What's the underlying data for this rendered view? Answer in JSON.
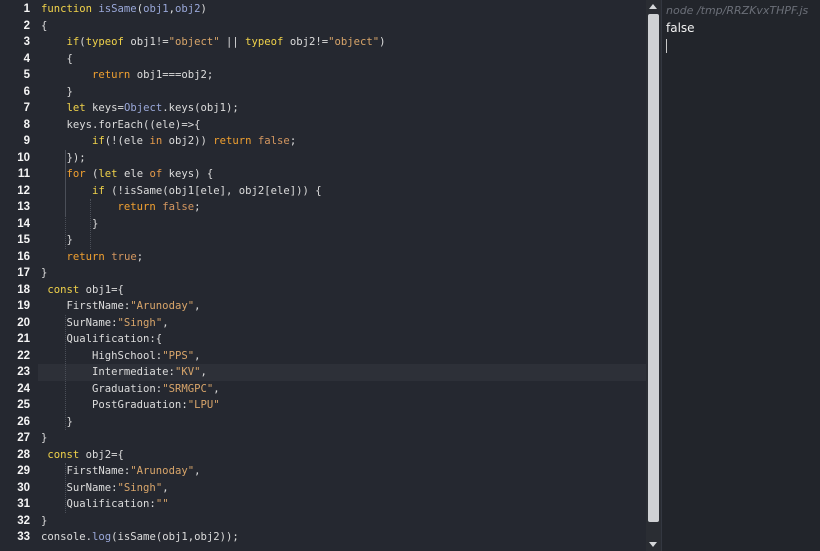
{
  "editor": {
    "line_numbers": [
      "1",
      "2",
      "3",
      "4",
      "5",
      "6",
      "7",
      "8",
      "9",
      "10",
      "11",
      "12",
      "13",
      "14",
      "15",
      "16",
      "17",
      "18",
      "19",
      "20",
      "21",
      "22",
      "23",
      "24",
      "25",
      "26",
      "27",
      "28",
      "29",
      "30",
      "31",
      "32",
      "33"
    ],
    "active_line": 23,
    "lines": [
      [
        [
          "k",
          "function"
        ],
        [
          "n",
          " "
        ],
        [
          "o",
          "isSame"
        ],
        [
          "n",
          "("
        ],
        [
          "o",
          "obj1"
        ],
        [
          "n",
          ","
        ],
        [
          "o",
          "obj2"
        ],
        [
          "n",
          ")"
        ]
      ],
      [
        [
          "n",
          "{"
        ]
      ],
      [
        [
          "n",
          "    "
        ],
        [
          "k",
          "if"
        ],
        [
          "n",
          "("
        ],
        [
          "k",
          "typeof"
        ],
        [
          "n",
          " obj1!="
        ],
        [
          "s",
          "\"object\""
        ],
        [
          "n",
          " || "
        ],
        [
          "k",
          "typeof"
        ],
        [
          "n",
          " obj2!="
        ],
        [
          "s",
          "\"object\""
        ],
        [
          "n",
          ")"
        ]
      ],
      [
        [
          "n",
          "    {"
        ]
      ],
      [
        [
          "n",
          "        "
        ],
        [
          "kr",
          "return"
        ],
        [
          "n",
          " obj1===obj2;"
        ]
      ],
      [
        [
          "n",
          "    }"
        ]
      ],
      [
        [
          "n",
          "    "
        ],
        [
          "k",
          "let"
        ],
        [
          "n",
          " keys="
        ],
        [
          "o",
          "Object"
        ],
        [
          "n",
          ".keys(obj1);"
        ]
      ],
      [
        [
          "n",
          "    keys.forEach((ele)=>{"
        ]
      ],
      [
        [
          "n",
          "        "
        ],
        [
          "k",
          "if"
        ],
        [
          "n",
          "(!(ele "
        ],
        [
          "kp",
          "in"
        ],
        [
          "n",
          " obj2)) "
        ],
        [
          "kr",
          "return"
        ],
        [
          "n",
          " "
        ],
        [
          "b",
          "false"
        ],
        [
          "n",
          ";"
        ]
      ],
      [
        [
          "n",
          "    });"
        ]
      ],
      [
        [
          "n",
          "    "
        ],
        [
          "kr",
          "for"
        ],
        [
          "n",
          " ("
        ],
        [
          "k",
          "let"
        ],
        [
          "n",
          " ele "
        ],
        [
          "kp",
          "of"
        ],
        [
          "n",
          " keys) {"
        ]
      ],
      [
        [
          "n",
          "        "
        ],
        [
          "k",
          "if"
        ],
        [
          "n",
          " (!isSame(obj1[ele], obj2[ele])) {"
        ]
      ],
      [
        [
          "n",
          "            "
        ],
        [
          "kr",
          "return"
        ],
        [
          "n",
          " "
        ],
        [
          "b",
          "false"
        ],
        [
          "n",
          ";"
        ]
      ],
      [
        [
          "n",
          "        }"
        ]
      ],
      [
        [
          "n",
          "    }"
        ]
      ],
      [
        [
          "n",
          "    "
        ],
        [
          "kr",
          "return"
        ],
        [
          "n",
          " "
        ],
        [
          "b",
          "true"
        ],
        [
          "n",
          ";"
        ]
      ],
      [
        [
          "n",
          "}"
        ]
      ],
      [
        [
          "n",
          " "
        ],
        [
          "k",
          "const"
        ],
        [
          "n",
          " obj1={"
        ]
      ],
      [
        [
          "n",
          "    FirstName:"
        ],
        [
          "s",
          "\"Arunoday\""
        ],
        [
          "n",
          ","
        ]
      ],
      [
        [
          "n",
          "    SurName:"
        ],
        [
          "s",
          "\"Singh\""
        ],
        [
          "n",
          ","
        ]
      ],
      [
        [
          "n",
          "    Qualification:{"
        ]
      ],
      [
        [
          "n",
          "        HighSchool:"
        ],
        [
          "s",
          "\"PPS\""
        ],
        [
          "n",
          ","
        ]
      ],
      [
        [
          "n",
          "        Intermediate:"
        ],
        [
          "s",
          "\"KV\""
        ],
        [
          "n",
          ","
        ]
      ],
      [
        [
          "n",
          "        Graduation:"
        ],
        [
          "s",
          "\"SRMGPC\""
        ],
        [
          "n",
          ","
        ]
      ],
      [
        [
          "n",
          "        PostGraduation:"
        ],
        [
          "s",
          "\"LPU\""
        ]
      ],
      [
        [
          "n",
          "    }"
        ]
      ],
      [
        [
          "n",
          "}"
        ]
      ],
      [
        [
          "n",
          " "
        ],
        [
          "k",
          "const"
        ],
        [
          "n",
          " obj2={"
        ]
      ],
      [
        [
          "n",
          "    FirstName:"
        ],
        [
          "s",
          "\"Arunoday\""
        ],
        [
          "n",
          ","
        ]
      ],
      [
        [
          "n",
          "    SurName:"
        ],
        [
          "s",
          "\"Singh\""
        ],
        [
          "n",
          ","
        ]
      ],
      [
        [
          "n",
          "    Qualification:"
        ],
        [
          "s",
          "\"\""
        ]
      ],
      [
        [
          "n",
          "}"
        ]
      ],
      [
        [
          "n",
          "console."
        ],
        [
          "o",
          "log"
        ],
        [
          "n",
          "(isSame(obj1,obj2));"
        ]
      ]
    ]
  },
  "output": {
    "header": "node /tmp/RRZKvxTHPF.js",
    "result": "false"
  },
  "colors": {
    "editor_bg": "#252830",
    "output_bg": "#22252b",
    "keyword": "#f0d24a",
    "return_keyword": "#f0a030",
    "string": "#d8a56a",
    "builtin": "#9aa8d9"
  }
}
